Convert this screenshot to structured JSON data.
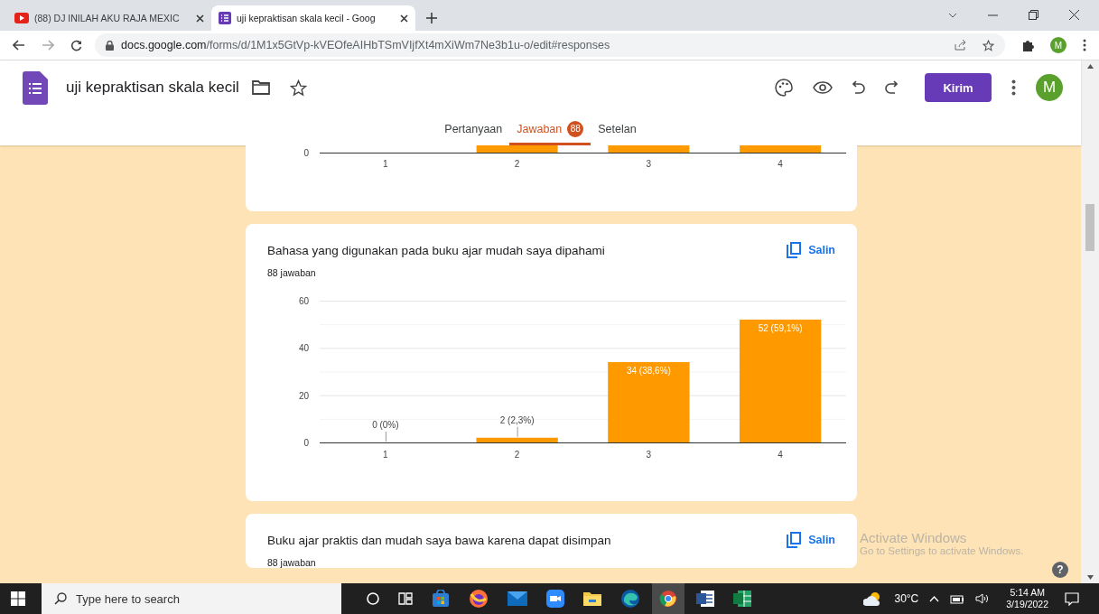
{
  "browser_tabs": [
    {
      "title": "(88) DJ INILAH AKU RAJA MEXIC",
      "kind": "video",
      "selected": false
    },
    {
      "title": "uji kepraktisan skala kecil - Goog",
      "kind": "form",
      "selected": true
    }
  ],
  "address": {
    "domain": "docs.google.com",
    "path": "/forms/d/1M1x5GtVp-kVEOfeAIHbTSmVIjfXt4mXiWm7Ne3b1u-o/edit#responses"
  },
  "profile_initial": "M",
  "form_header": {
    "title": "uji kepraktisan skala kecil",
    "send_button": "Kirim",
    "avatar": "M"
  },
  "form_tabs": [
    {
      "label": "Pertanyaan",
      "selected": false
    },
    {
      "label": "Jawaban",
      "selected": true,
      "badge": "88"
    },
    {
      "label": "Setelan",
      "selected": false
    }
  ],
  "partial_card": {
    "ytick": "0",
    "categories": [
      {
        "label": "1",
        "bar": false
      },
      {
        "label": "2",
        "bar": true
      },
      {
        "label": "3",
        "bar": true
      },
      {
        "label": "4",
        "bar": true
      }
    ]
  },
  "questions": [
    {
      "title": "Bahasa yang digunakan pada buku ajar mudah saya dipahami",
      "count": "88 jawaban",
      "copy_button": "Salin",
      "chart_data": {
        "type": "bar",
        "categories": [
          "1",
          "2",
          "3",
          "4"
        ],
        "values": [
          0,
          2,
          34,
          52
        ],
        "ylim": [
          0,
          60
        ],
        "yticks": [
          0,
          20,
          40,
          60
        ],
        "value_labels": [
          "0 (0%)",
          "2 (2,3%)",
          "34 (38,6%)",
          "52 (59,1%)"
        ]
      }
    },
    {
      "title": "Buku ajar praktis dan mudah saya bawa karena dapat disimpan",
      "count": "88 jawaban",
      "copy_button": "Salin"
    }
  ],
  "windows_notice": {
    "title": "Activate Windows",
    "subtitle": "Go to Settings to activate Windows."
  },
  "help_button": "?",
  "taskbar": {
    "search_placeholder": "Type here to search",
    "temperature": "30°C",
    "time": "5:14 AM",
    "date": "3/19/2022"
  }
}
